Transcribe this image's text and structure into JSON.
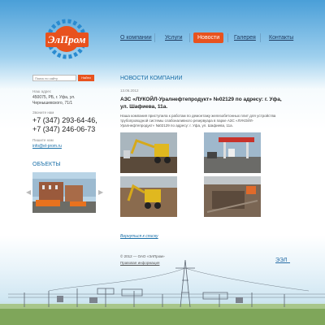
{
  "logo": {
    "text": "ЭлПром"
  },
  "nav": {
    "items": [
      {
        "label": "О компании"
      },
      {
        "label": "Услуги"
      },
      {
        "label": "Новости"
      },
      {
        "label": "Галерея"
      },
      {
        "label": "Контакты"
      }
    ],
    "active_index": 2
  },
  "search": {
    "placeholder": "Поиск по сайту",
    "button_label": "Найти"
  },
  "contacts": {
    "address_label": "Наш адрес",
    "address_lines": [
      "450075, РБ, г. Уфа, ул.",
      "Чернышевского, 71/1"
    ],
    "phone_label": "Звоните нам",
    "phones": [
      "+7 (347) 293-64-46,",
      "+7 (347) 246-06-73"
    ],
    "email_label": "Пишите нам",
    "email": "info@el-prom.ru"
  },
  "objects": {
    "title": "ОБЪЕКТЫ"
  },
  "news": {
    "heading": "НОВОСТИ КОМПАНИИ",
    "date": "13.06.2012",
    "title": "АЗС «ЛУКОЙЛ-Уралнефтепродукт» №02129 по адресу: г. Уфа, ул. Шафиева, 11а.",
    "body": "Наша компания приступила к работам по демонтажу железобетонных плит для устройства трубопроводной системы слабоналивного резервуара в парке АЗС «ЛУКОЙЛ-Уралнефтепродукт» №02129 по адресу: г. Уфа, ул. Шафиева, 11а.",
    "back_link": "Вернуться к списку"
  },
  "footer": {
    "copyright": "© 2012 — ОАО «ЭлПром»",
    "privacy": "Правовая информация",
    "dev_logo": "ЭЭЛ"
  },
  "colors": {
    "accent": "#e8521e",
    "link": "#1a6fa8",
    "nav": "#1f3b60"
  }
}
